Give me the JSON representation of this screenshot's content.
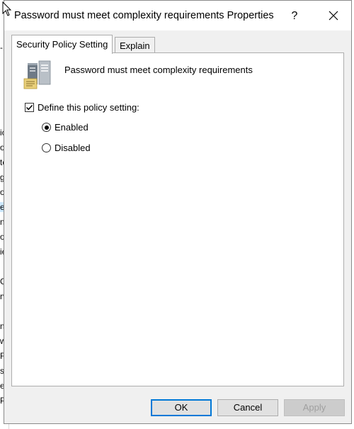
{
  "background_window": {
    "fragments": [
      "-1",
      "ic",
      "o/",
      "te",
      "g",
      "o",
      "er",
      "nt",
      "os",
      "ie",
      "G",
      "rv",
      "n",
      "w",
      "Fi",
      "st",
      "e",
      "P"
    ]
  },
  "dialog": {
    "title": "Password must meet complexity requirements Properties",
    "help_label": "?",
    "tabs": [
      {
        "label": "Security Policy Setting",
        "active": true
      },
      {
        "label": "Explain",
        "active": false
      }
    ],
    "policy_name": "Password must meet complexity requirements",
    "define_checkbox": {
      "label": "Define this policy setting:",
      "checked": true
    },
    "options": [
      {
        "label": "Enabled",
        "selected": true
      },
      {
        "label": "Disabled",
        "selected": false
      }
    ],
    "buttons": {
      "ok": "OK",
      "cancel": "Cancel",
      "apply": "Apply"
    }
  },
  "icons": {
    "policy": "server-policy-icon",
    "close": "close-icon",
    "cursor": "mouse-pointer-icon"
  }
}
